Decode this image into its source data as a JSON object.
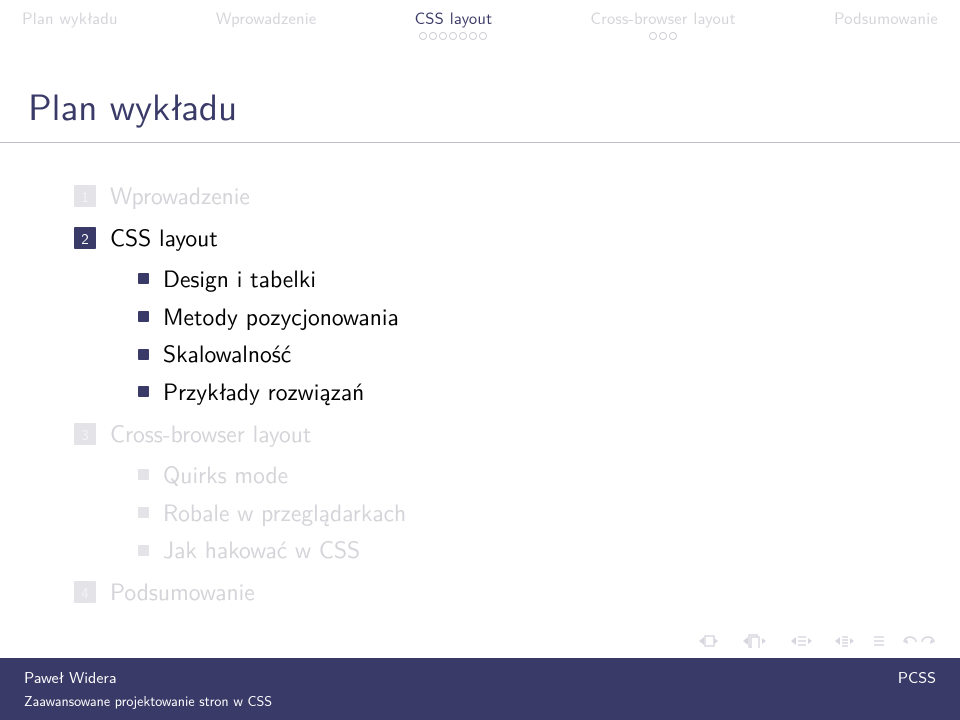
{
  "nav": {
    "items": [
      {
        "label": "Plan wykładu",
        "active": false,
        "dots": 0
      },
      {
        "label": "Wprowadzenie",
        "active": false,
        "dots": 0
      },
      {
        "label": "CSS layout",
        "active": true,
        "dots": 7
      },
      {
        "label": "Cross-browser layout",
        "active": false,
        "dots": 3
      },
      {
        "label": "Podsumowanie",
        "active": false,
        "dots": 0
      }
    ]
  },
  "title": "Plan wykładu",
  "outline": {
    "sections": [
      {
        "num": "1",
        "label": "Wprowadzenie",
        "active": false,
        "subs": []
      },
      {
        "num": "2",
        "label": "CSS layout",
        "active": true,
        "subs": [
          {
            "label": "Design i tabelki",
            "active": true
          },
          {
            "label": "Metody pozycjonowania",
            "active": true
          },
          {
            "label": "Skalowalność",
            "active": true
          },
          {
            "label": "Przykłady rozwiązań",
            "active": true
          }
        ]
      },
      {
        "num": "3",
        "label": "Cross-browser layout",
        "active": false,
        "subs": [
          {
            "label": "Quirks mode",
            "active": false
          },
          {
            "label": "Robale w przeglądarkach",
            "active": false
          },
          {
            "label": "Jak hakować w CSS",
            "active": false
          }
        ]
      },
      {
        "num": "4",
        "label": "Podsumowanie",
        "active": false,
        "subs": []
      }
    ]
  },
  "footer": {
    "author": "Paweł Widera",
    "org": "PCSS",
    "subtitle": "Zaawansowane projektowanie stron w CSS"
  }
}
